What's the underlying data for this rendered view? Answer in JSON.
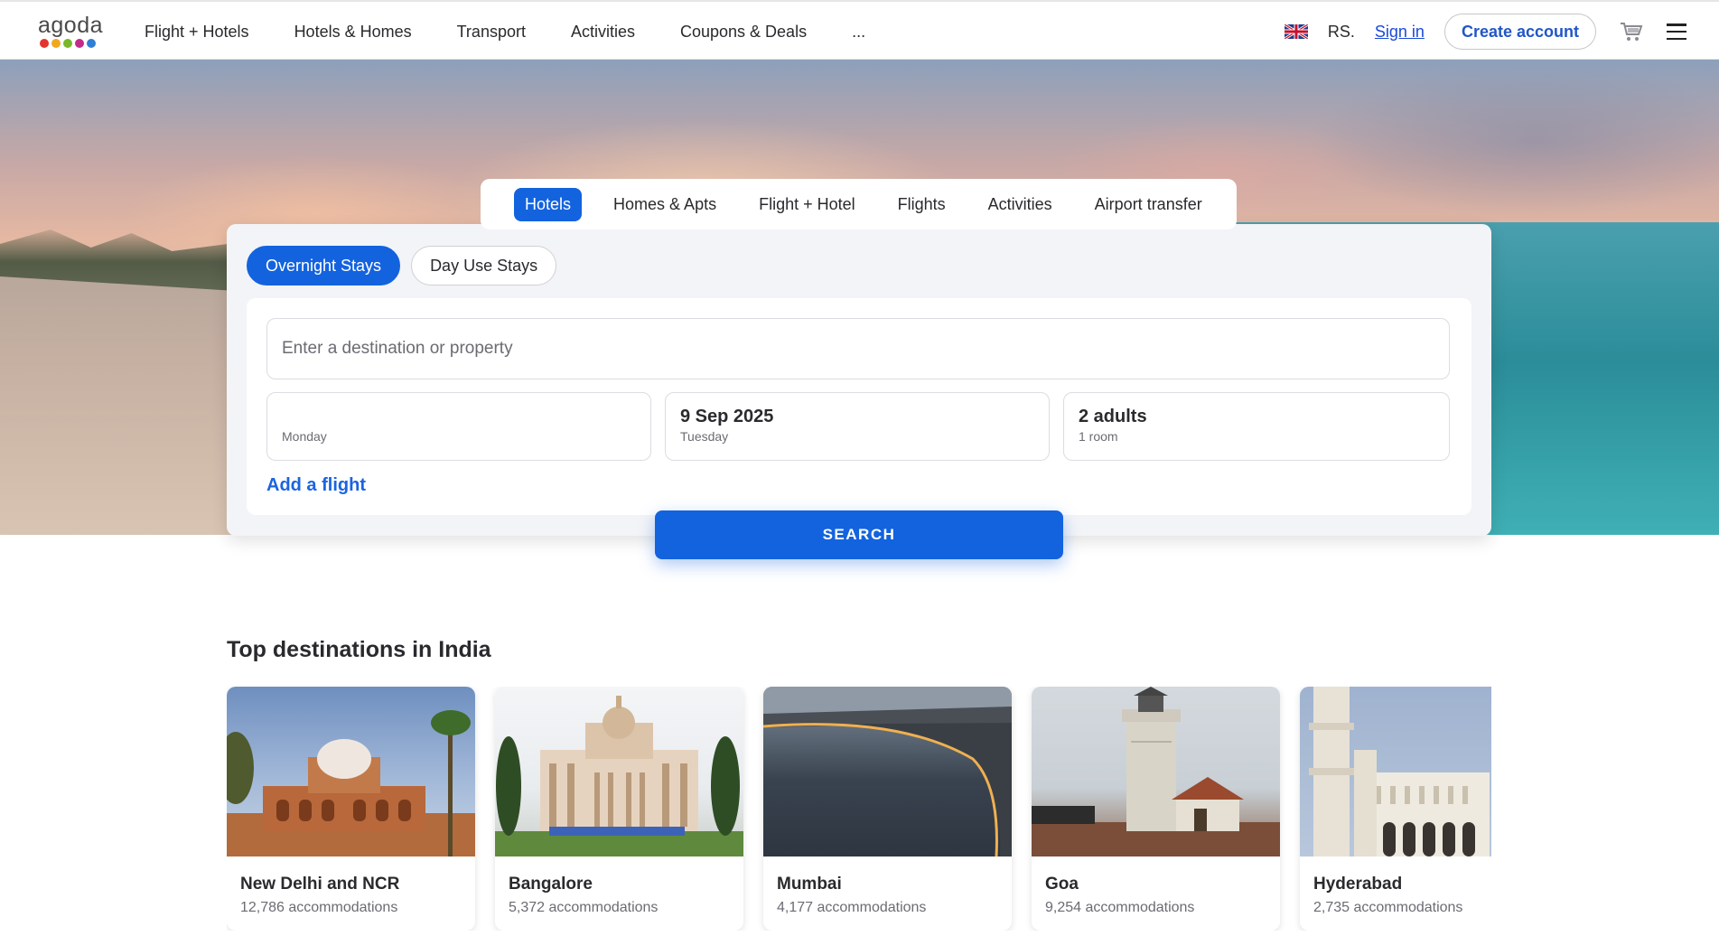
{
  "header": {
    "logo_text": "agoda",
    "logo_colors": [
      "#e2352e",
      "#f2a81d",
      "#79b828",
      "#c22a8b",
      "#2e7fd6"
    ],
    "nav": [
      "Flight + Hotels",
      "Hotels & Homes",
      "Transport",
      "Activities",
      "Coupons & Deals",
      "..."
    ],
    "currency": "RS.",
    "sign_in": "Sign in",
    "create_account": "Create account"
  },
  "search": {
    "vertical_tabs": [
      {
        "label": "Hotels",
        "active": true
      },
      {
        "label": "Homes & Apts",
        "active": false
      },
      {
        "label": "Flight + Hotel",
        "active": false
      },
      {
        "label": "Flights",
        "active": false
      },
      {
        "label": "Activities",
        "active": false
      },
      {
        "label": "Airport transfer",
        "active": false
      }
    ],
    "stay_types": [
      {
        "label": "Overnight Stays",
        "active": true
      },
      {
        "label": "Day Use Stays",
        "active": false
      }
    ],
    "destination_placeholder": "Enter a destination or property",
    "checkin": {
      "date": "",
      "day": "Monday"
    },
    "checkout": {
      "date": "9 Sep 2025",
      "day": "Tuesday"
    },
    "occupancy": {
      "guests": "2 adults",
      "rooms": "1 room"
    },
    "add_flight": "Add a flight",
    "search_button": "SEARCH",
    "accent_color": "#1363df"
  },
  "destinations": {
    "title": "Top destinations in India",
    "items": [
      {
        "name": "New Delhi and NCR",
        "count": "12,786 accommodations"
      },
      {
        "name": "Bangalore",
        "count": "5,372 accommodations"
      },
      {
        "name": "Mumbai",
        "count": "4,177 accommodations"
      },
      {
        "name": "Goa",
        "count": "9,254 accommodations"
      },
      {
        "name": "Hyderabad",
        "count": "2,735 accommodations"
      }
    ]
  }
}
